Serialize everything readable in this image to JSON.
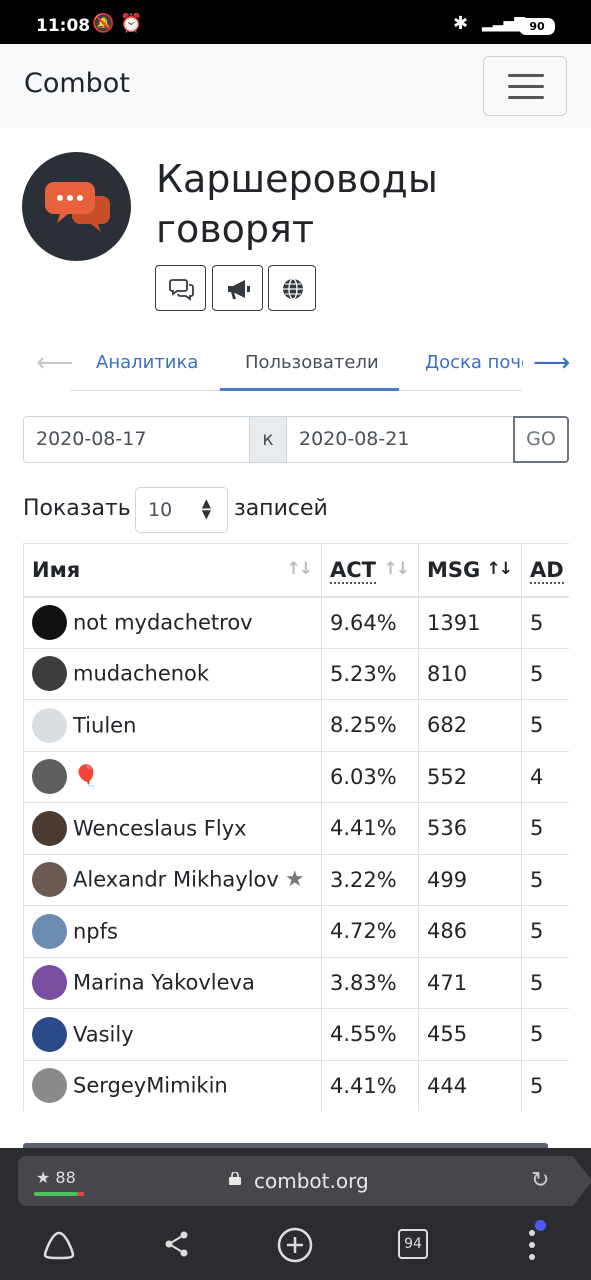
{
  "status_bar": {
    "time": "11:08",
    "battery": "90"
  },
  "navbar": {
    "brand": "Combot"
  },
  "group": {
    "title": "Каршероводы говорят"
  },
  "tabs": [
    {
      "label": "Аналитика"
    },
    {
      "label": "Пользователи"
    },
    {
      "label": "Доска поче"
    }
  ],
  "date_range": {
    "from": "2020-08-17",
    "separator": "к",
    "to": "2020-08-21",
    "go_label": "GO"
  },
  "length_menu": {
    "show_label": "Показать",
    "value": "10",
    "entries_label": "записей"
  },
  "table": {
    "headers": {
      "name": "Имя",
      "act": "ACT",
      "msg": "MSG",
      "ad": "AD"
    },
    "rows": [
      {
        "name": "not mydachetrov",
        "act": "9.64%",
        "msg": "1391",
        "ad": "5",
        "avatar_color": "#111111"
      },
      {
        "name": "mudachenok",
        "act": "5.23%",
        "msg": "810",
        "ad": "5",
        "avatar_color": "#3d3d3d"
      },
      {
        "name": "Tiulen",
        "act": "8.25%",
        "msg": "682",
        "ad": "5",
        "avatar_color": "#d9dee3"
      },
      {
        "name": "🎈",
        "act": "6.03%",
        "msg": "552",
        "ad": "4",
        "avatar_color": "#5e5e5e"
      },
      {
        "name": "Wenceslaus Flyx",
        "act": "4.41%",
        "msg": "536",
        "ad": "5",
        "avatar_color": "#4a3a30"
      },
      {
        "name": "Alexandr Mikhaylov",
        "act": "3.22%",
        "msg": "499",
        "ad": "5",
        "avatar_color": "#6a5a50"
      },
      {
        "name": "npfs",
        "act": "4.72%",
        "msg": "486",
        "ad": "5",
        "avatar_color": "#6b8bb0"
      },
      {
        "name": "Marina Yakovleva",
        "act": "3.83%",
        "msg": "471",
        "ad": "5",
        "avatar_color": "#7a4fa0"
      },
      {
        "name": "Vasily",
        "act": "4.55%",
        "msg": "455",
        "ad": "5",
        "avatar_color": "#2a4a8a"
      },
      {
        "name": "SergeyMimikin",
        "act": "4.41%",
        "msg": "444",
        "ad": "5",
        "avatar_color": "#8a8a8a"
      }
    ]
  },
  "browser": {
    "rating": "★ 88",
    "url": "combot.org",
    "tabs_count": "94"
  },
  "colors": {
    "accent": "#3a6fc8",
    "orange_icon": "#e8613c",
    "dark_logo": "#2b2f38"
  }
}
